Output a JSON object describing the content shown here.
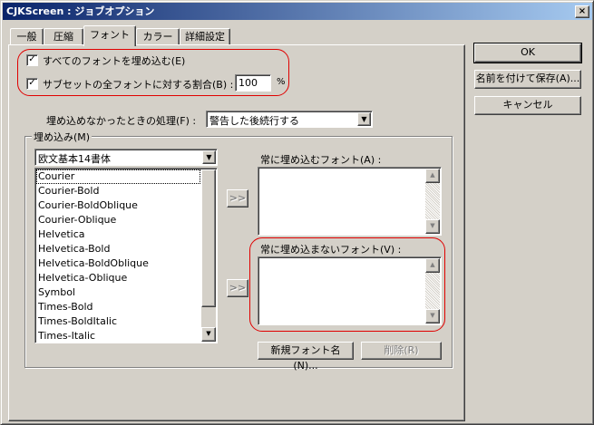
{
  "window": {
    "title": "CJKScreen : ジョブオプション",
    "close_label": "×"
  },
  "tabs": [
    {
      "label": "一般"
    },
    {
      "label": "圧縮"
    },
    {
      "label": "フォント"
    },
    {
      "label": "カラー"
    },
    {
      "label": "詳細設定"
    }
  ],
  "active_tab": "フォント",
  "embed_all": {
    "checked": true,
    "mark": "✓",
    "label": "すべてのフォントを埋め込む(E)"
  },
  "subset": {
    "checked": true,
    "mark": "✓",
    "label": "サブセットの全フォントに対する割合(B) :",
    "value": "100",
    "unit": "%"
  },
  "fail_action": {
    "label": "埋め込めなかったときの処理(F) :",
    "value": "警告した後続行する"
  },
  "embed_group": {
    "title": "埋め込み(M)",
    "source_dropdown": "欧文基本14書体",
    "fonts": [
      "Courier",
      "Courier-Bold",
      "Courier-BoldOblique",
      "Courier-Oblique",
      "Helvetica",
      "Helvetica-Bold",
      "Helvetica-BoldOblique",
      "Helvetica-Oblique",
      "Symbol",
      "Times-Bold",
      "Times-BoldItalic",
      "Times-Italic"
    ],
    "move_button_label": ">>",
    "always_embed_label": "常に埋め込むフォント(A) :",
    "never_embed_label": "常に埋め込まないフォント(V) :",
    "new_font_button": "新規フォント名(N)...",
    "delete_button": "削除(R)"
  },
  "side_buttons": {
    "ok": "OK",
    "save_as": "名前を付けて保存(A)...",
    "cancel": "キャンセル"
  },
  "highlight_color": "#e00000"
}
